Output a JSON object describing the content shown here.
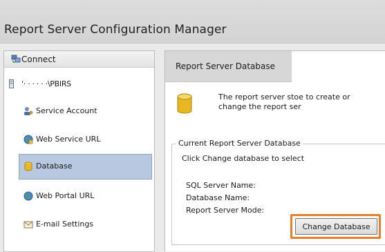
{
  "window": {
    "title": "Report Server Configuration Manager"
  },
  "nav": {
    "connect_label": "Connect",
    "server_label": "'· · · · · ·\\PBIRS",
    "items": [
      {
        "label": "Service Account",
        "icon": "service-account-icon"
      },
      {
        "label": "Web Service URL",
        "icon": "globe-icon"
      },
      {
        "label": "Database",
        "icon": "database-icon",
        "selected": true
      },
      {
        "label": "Web Portal URL",
        "icon": "globe-icon"
      },
      {
        "label": "E-mail Settings",
        "icon": "email-icon"
      }
    ]
  },
  "main": {
    "header": "Report Server Database",
    "description": "The report server stoe to create or change the report ser",
    "group": {
      "legend": "Current Report Server Database",
      "hint": "Click Change database to select",
      "fields": [
        "SQL Server Name:",
        "Database Name:",
        "Report Server Mode:"
      ]
    },
    "change_button": "Change Database"
  },
  "colors": {
    "accent": "#e87e2a",
    "selected_bg": "#b8c8e0"
  }
}
